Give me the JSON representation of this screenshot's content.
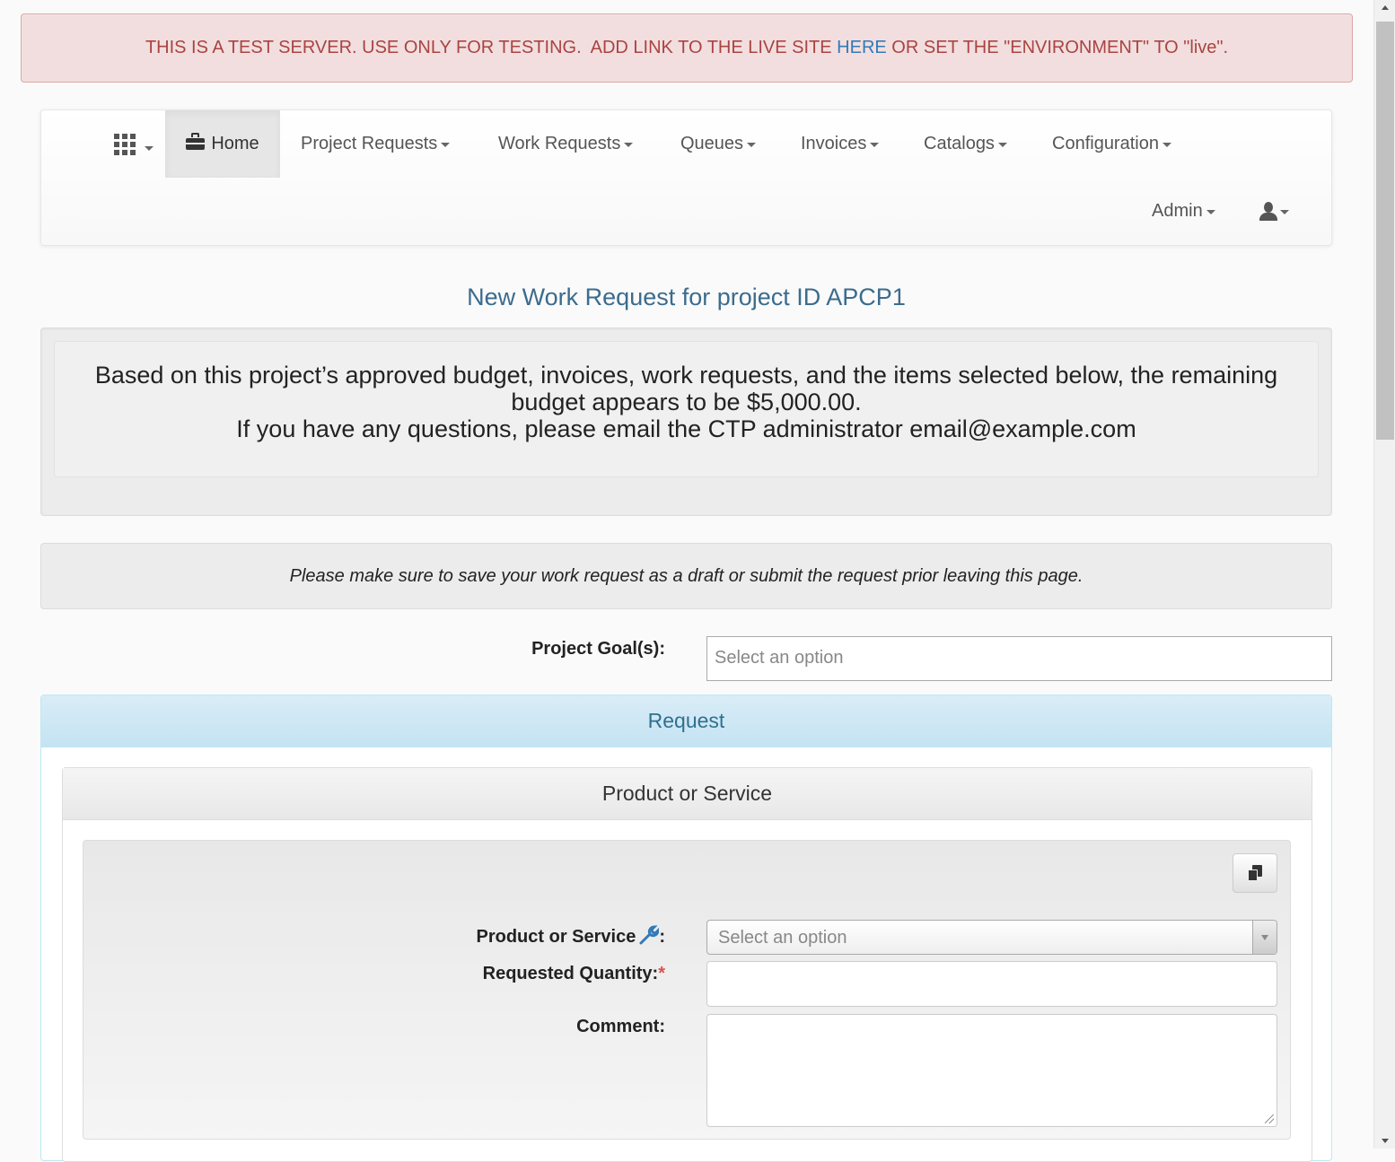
{
  "banner": {
    "text_before": "THIS IS A TEST SERVER. USE ONLY FOR TESTING.  ADD LINK TO THE LIVE SITE ",
    "link_text": "HERE",
    "text_after": " OR SET THE \"ENVIRONMENT\" TO \"live\"."
  },
  "nav": {
    "apps_icon": "grid-icon",
    "home": "Home",
    "items": [
      "Project Requests",
      "Work Requests",
      "Queues",
      "Invoices",
      "Catalogs",
      "Configuration"
    ],
    "admin": "Admin",
    "user_icon": "user-icon"
  },
  "page_title": "New Work Request for project ID APCP1",
  "budget": {
    "line1": "Based on this project’s approved budget, invoices, work requests, and the items selected below, the remaining",
    "line2": "budget appears to be $5,000.00.",
    "line3": "If you have any questions, please email the CTP administrator email@example.com"
  },
  "note": "Please make sure to save your work request as a draft or submit the request prior leaving this page.",
  "goals": {
    "label": "Project Goal(s):",
    "placeholder": "Select an option"
  },
  "request": {
    "heading": "Request",
    "product_heading": "Product or Service",
    "product_label": "Product or Service",
    "product_label_suffix": ":",
    "product_placeholder": "Select an option",
    "quantity_label": "Requested Quantity:",
    "required_mark": "*",
    "comment_label": "Comment:"
  },
  "colors": {
    "banner_text": "#a94442",
    "link": "#337ab7",
    "title": "#3b6c8e",
    "info_heading": "#31708f"
  }
}
